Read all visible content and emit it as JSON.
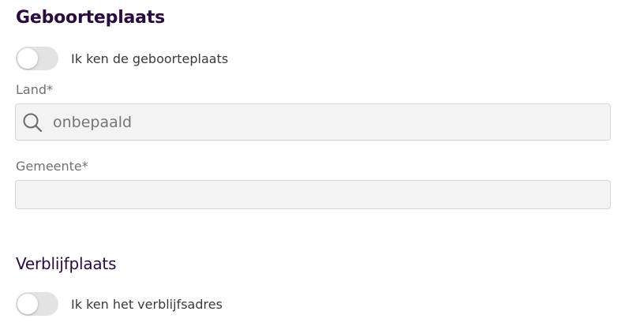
{
  "birthplace": {
    "title": "Geboorteplaats",
    "toggle_label": "Ik ken de geboorteplaats",
    "country": {
      "label": "Land*",
      "placeholder": "onbepaald"
    },
    "municipality": {
      "label": "Gemeente*"
    }
  },
  "residence": {
    "title": "Verblijfplaats",
    "toggle_label": "Ik ken het verblijfsadres"
  },
  "colors": {
    "heading": "#2b0a3d",
    "input_background": "#f3f3f3",
    "toggle_off": "#e3e3e3"
  }
}
